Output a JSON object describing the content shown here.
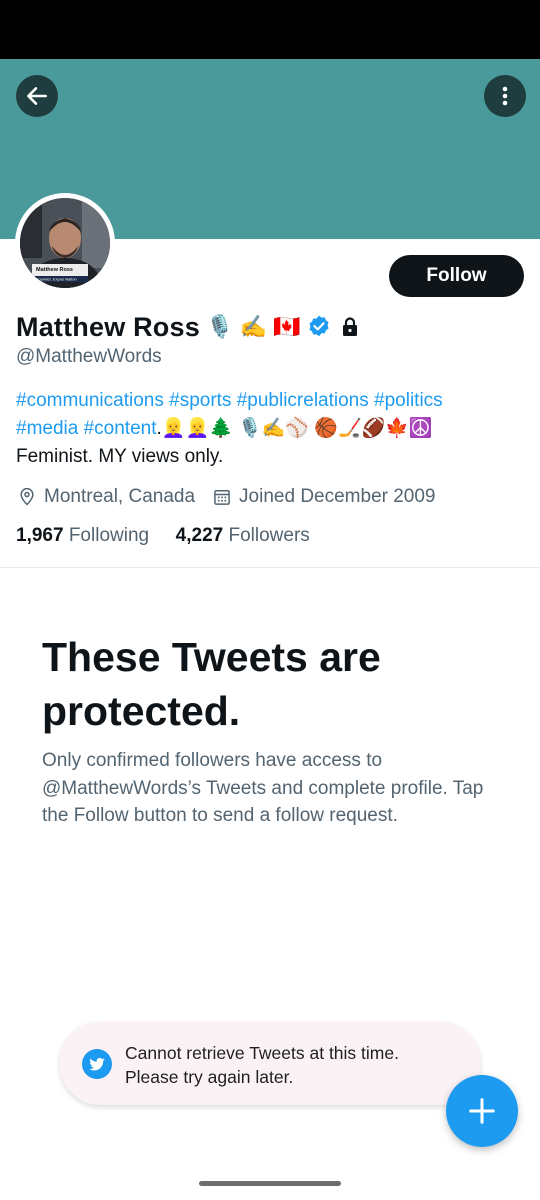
{
  "profile": {
    "name": "Matthew Ross",
    "name_emojis": "🎙️ ✍️ 🇨🇦",
    "handle": "@MatthewWords",
    "follow_label": "Follow",
    "avatar_caption_name": "Matthew Ross",
    "avatar_caption_sub": "Founder, Expos Nation"
  },
  "bio": {
    "line1": [
      {
        "text": "#communications",
        "type": "hashtag"
      },
      {
        "text": " ",
        "type": "text"
      },
      {
        "text": "#sports",
        "type": "hashtag"
      },
      {
        "text": " ",
        "type": "text"
      },
      {
        "text": "#publicrelations",
        "type": "hashtag"
      },
      {
        "text": " ",
        "type": "text"
      },
      {
        "text": "#politics",
        "type": "hashtag"
      }
    ],
    "line2": [
      {
        "text": "#media",
        "type": "hashtag"
      },
      {
        "text": " ",
        "type": "text"
      },
      {
        "text": "#content",
        "type": "hashtag"
      },
      {
        "text": ".👱‍♀️👱‍♀️🌲 🎙️✍️⚾️ 🏀🏒🏈🍁☮️",
        "type": "text"
      }
    ],
    "line3": "Feminist. MY views only."
  },
  "meta": {
    "location": "Montreal, Canada",
    "joined": "Joined December 2009"
  },
  "counts": {
    "following_count": "1,967",
    "following_label": "Following",
    "followers_count": "4,227",
    "followers_label": "Followers"
  },
  "protected": {
    "title": "These Tweets are protected.",
    "body": "Only confirmed followers have access to @MatthewWords’s Tweets and complete profile. Tap the Follow button to send a follow request."
  },
  "toast": {
    "line1": "Cannot retrieve Tweets at this time.",
    "line2": "Please try again later."
  },
  "colors": {
    "banner": "#4a9a9b",
    "accent": "#1d9bf0",
    "text_primary": "#0f1419",
    "text_secondary": "#536471"
  },
  "icons": {
    "back": "arrow-left-icon",
    "more": "more-vertical-icon",
    "verified": "verified-badge-icon",
    "protected": "lock-icon",
    "location": "location-pin-icon",
    "calendar": "calendar-icon",
    "twitter": "twitter-bird-icon",
    "compose": "plus-icon"
  }
}
